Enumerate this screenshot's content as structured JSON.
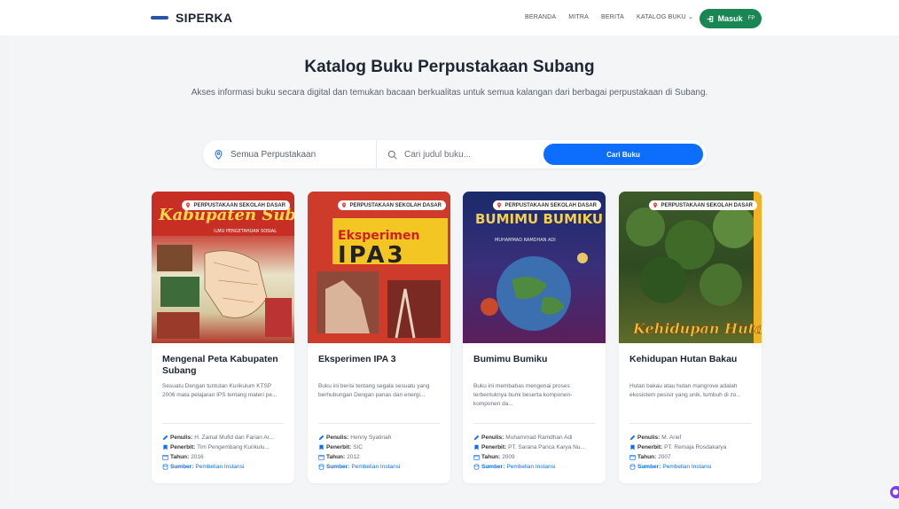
{
  "brand": {
    "name": "SIPERKA"
  },
  "nav": {
    "items": [
      {
        "label": "BERANDA"
      },
      {
        "label": "MITRA"
      },
      {
        "label": "BERITA"
      },
      {
        "label": "KATALOG BUKU"
      }
    ],
    "login_label": "Masuk",
    "login_extra": "FP"
  },
  "hero": {
    "title": "Katalog Buku Perpustakaan Subang",
    "subtitle": "Akses informasi buku secara digital dan temukan bacaan berkualitas untuk semua kalangan dari berbagai perpustakaan di Subang."
  },
  "search": {
    "library_label": "Semua Perpustakaan",
    "placeholder": "Cari judul buku...",
    "button_label": "Cari Buku"
  },
  "books": [
    {
      "badge": "PERPUSTAKAAN SEKOLAH DASAR",
      "title": "Mengenal Peta Kabupaten Subang",
      "description": "Sesuatu Dengan tuntutan Kurikulum KTSP 2006 mata pelajaran IPS tentang materi pe...",
      "author_label": "Penulis:",
      "author": "H. Zainal Mufid dan Farian Ar...",
      "publisher_label": "Penerbit:",
      "publisher": "Tim Pengembang Kurikulu...",
      "year_label": "Tahun:",
      "year": "2016",
      "source_label": "Sumber:",
      "source": "Pembelian Instansi",
      "cover_text": "Kabupaten Subang",
      "cover_subtext": "ILMU PENGETAHUAN SOSIAL"
    },
    {
      "badge": "PERPUSTAKAAN SEKOLAH DASAR",
      "title": "Eksperimen IPA 3",
      "description": "Buku ini berisi tentang segala sesuatu yang berhubungan Dengan panas dan energi...",
      "author_label": "Penulis:",
      "author": "Henny Syatiriah",
      "publisher_label": "Penerbit:",
      "publisher": "SIC",
      "year_label": "Tahun:",
      "year": "2012",
      "source_label": "Sumber:",
      "source": "Pembelian Instansi",
      "cover_text": "Eksperimen",
      "cover_subtext": "IPA3"
    },
    {
      "badge": "PERPUSTAKAAN SEKOLAH DASAR",
      "title": "Bumimu Bumiku",
      "description": "Buku ini membahas mengenai proses terbentuknya bumi beserta komponen-komponen da...",
      "author_label": "Penulis:",
      "author": "Muhammad Ramdhan Adi",
      "publisher_label": "Penerbit:",
      "publisher": "PT. Sarana Panca Karya Nu...",
      "year_label": "Tahun:",
      "year": "2009",
      "source_label": "Sumber:",
      "source": "Pembelian Instansi",
      "cover_text": "BUMIMU BUMIKU",
      "cover_subtext": "MUHAMMAD RAMDHAN ADI"
    },
    {
      "badge": "PERPUSTAKAAN SEKOLAH DASAR",
      "title": "Kehidupan Hutan Bakau",
      "description": "Hutan bakau atau hutan mangrove adalah ekosistem pesisir yang unik, tumbuh di zo...",
      "author_label": "Penulis:",
      "author": "M. Arief",
      "publisher_label": "Penerbit:",
      "publisher": "PT. Remaja Rosdakarya",
      "year_label": "Tahun:",
      "year": "2007",
      "source_label": "Sumber:",
      "source": "Pembelian Instansi",
      "cover_text": "Kehidupan Hutan",
      "cover_subtext": ""
    }
  ],
  "colors": {
    "primary": "#0d6efd",
    "login": "#198754",
    "background": "#f3f5f7"
  }
}
